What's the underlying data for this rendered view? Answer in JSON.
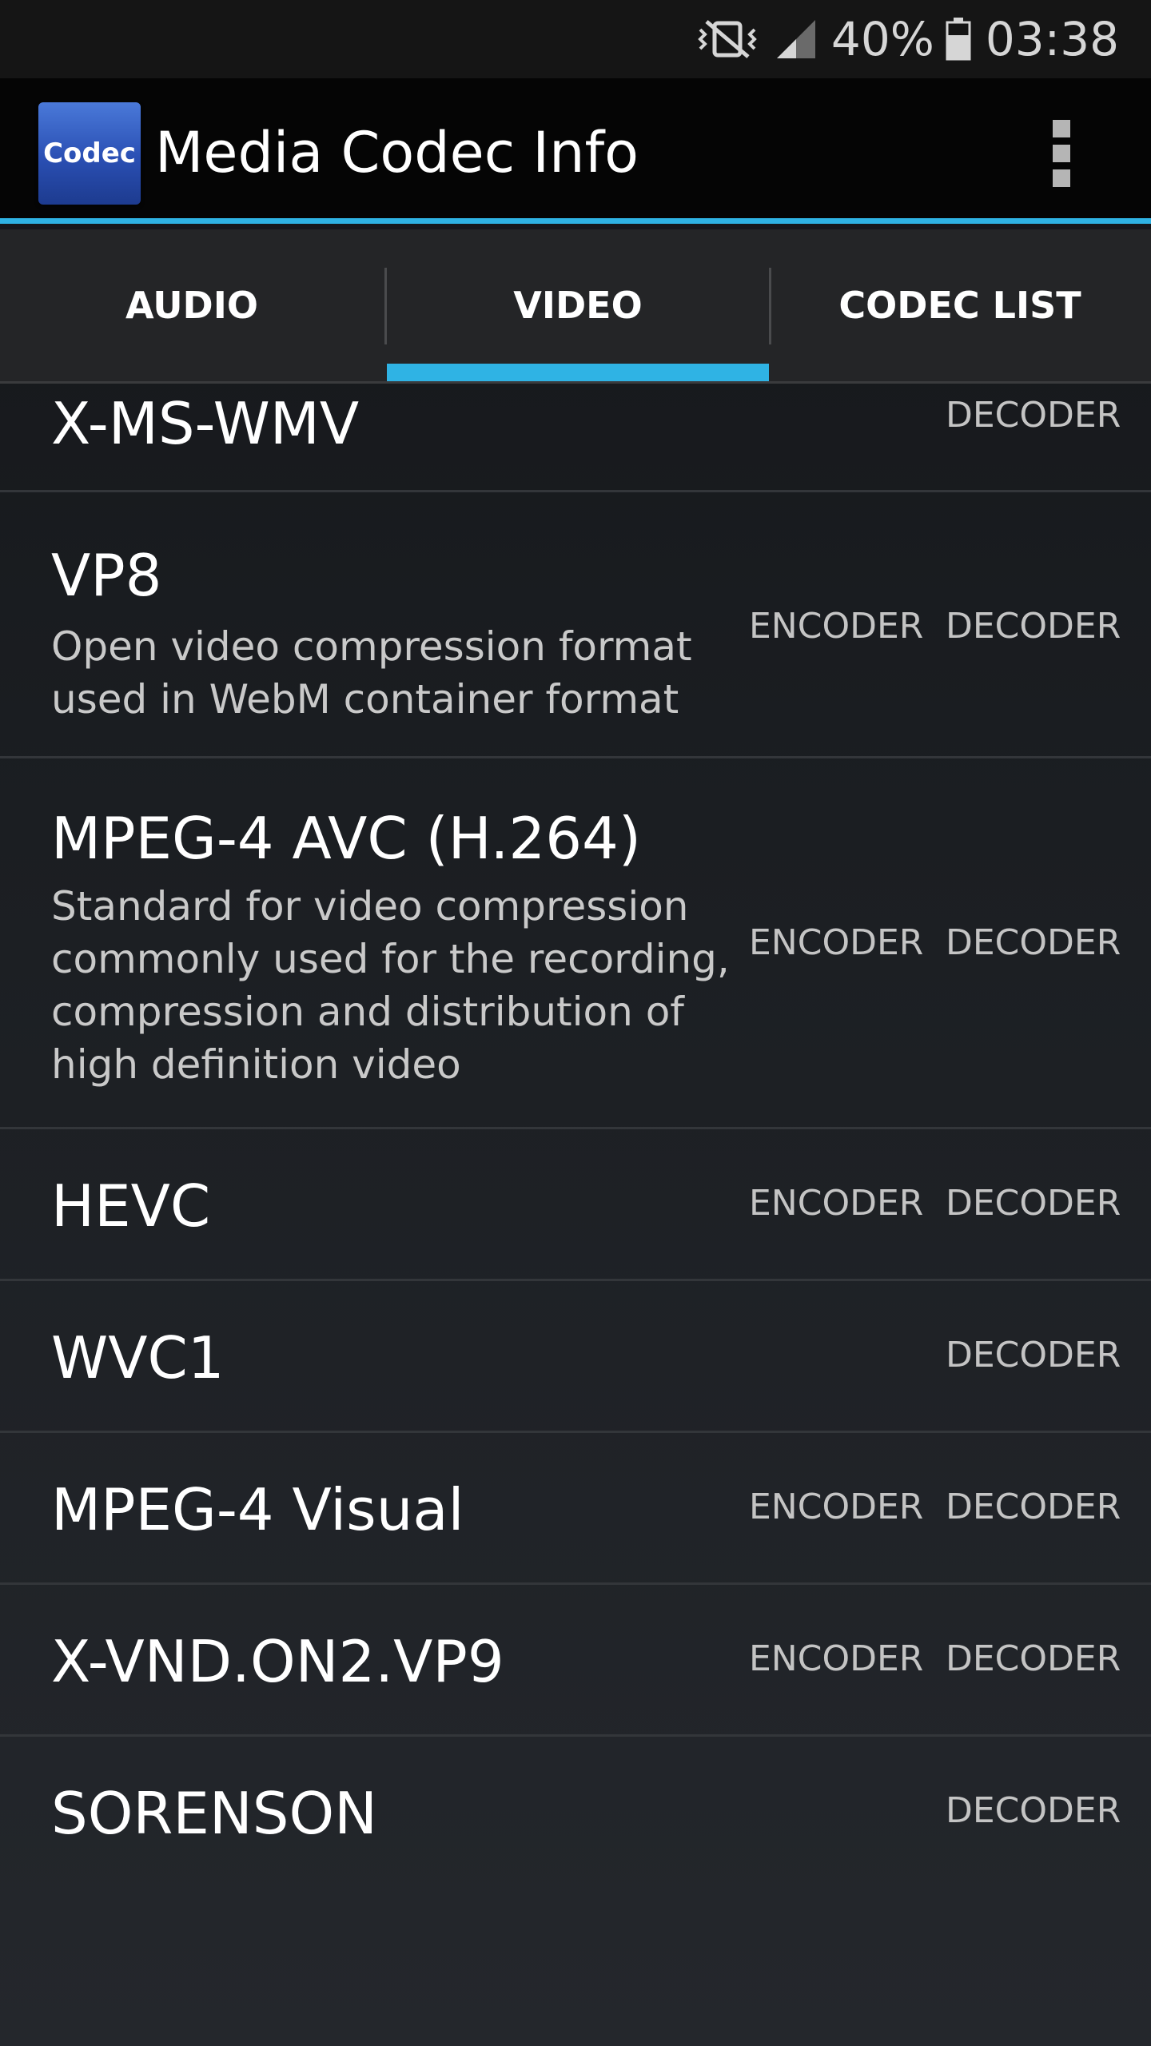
{
  "status_bar": {
    "battery": "40%",
    "time": "03:38",
    "icons": [
      "vibrate-icon",
      "signal-icon",
      "battery-icon"
    ]
  },
  "app_bar": {
    "logo_text": "Codec",
    "title": "Media Codec Info",
    "menu_icon": "overflow-menu-icon"
  },
  "tabs": [
    {
      "label": "AUDIO"
    },
    {
      "label": "VIDEO",
      "selected": true
    },
    {
      "label": "CODEC LIST"
    }
  ],
  "codecs": [
    {
      "name": "X-MS-WMV",
      "decoder": "DECODER"
    },
    {
      "name": "VP8",
      "description": "Open video compression format used in WebM container format",
      "encoder": "ENCODER",
      "decoder": "DECODER"
    },
    {
      "name": "MPEG-4 AVC (H.264)",
      "description": "Standard for video compression commonly used for the recording, compression and distribution of high definition video",
      "encoder": "ENCODER",
      "decoder": "DECODER"
    },
    {
      "name": "HEVC",
      "encoder": "ENCODER",
      "decoder": "DECODER"
    },
    {
      "name": "WVC1",
      "decoder": "DECODER"
    },
    {
      "name": "MPEG-4 Visual",
      "encoder": "ENCODER",
      "decoder": "DECODER"
    },
    {
      "name": "X-VND.ON2.VP9",
      "encoder": "ENCODER",
      "decoder": "DECODER"
    },
    {
      "name": "SORENSON",
      "decoder": "DECODER"
    }
  ],
  "colors": {
    "accent": "#2fb3e4",
    "app_bar": "#050505",
    "tab_bar": "#242527",
    "list_bg": "#1b1e22"
  }
}
